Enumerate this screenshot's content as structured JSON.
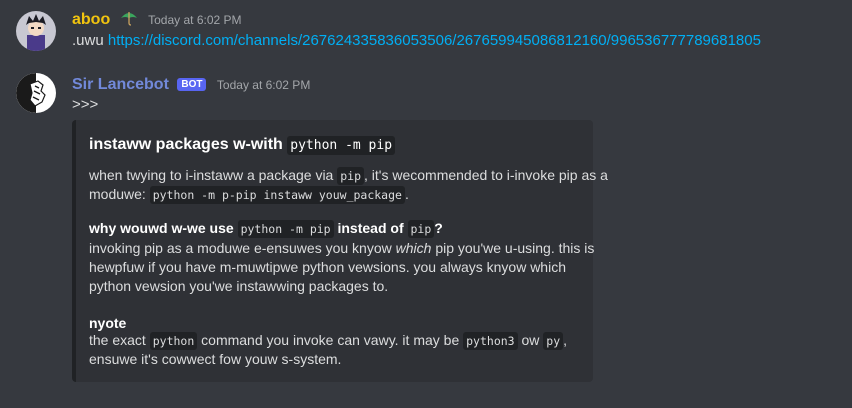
{
  "messages": [
    {
      "username": "aboo",
      "username_color": "#f1c40f",
      "badge_icon": "umbrella-icon",
      "timestamp": "Today at 6:02 PM",
      "text_prefix": ".uwu",
      "link": "https://discord.com/channels/267624335836053506/267659945086812160/996536777789681805"
    },
    {
      "username": "Sir Lancebot",
      "username_color": "#7289da",
      "bot_tag": "BOT",
      "timestamp": "Today at 6:02 PM",
      "text": ">>>"
    }
  ],
  "embed": {
    "title_text": "instaww packages w-with",
    "title_code": "python -m pip",
    "p1_line1_a": "when twying to i-instaww a package via",
    "p1_line1_code": "pip",
    "p1_line1_b": ", it's wecommended to i-invoke pip as a",
    "p1_line2_a": "moduwe:",
    "p1_line2_code": "python -m p-pip instaww youw_package",
    "p1_line2_b": ".",
    "h2_a": "why wouwd w-we use",
    "h2_code1": "python -m pip",
    "h2_b": "instead of",
    "h2_code2": "pip",
    "h2_c": "?",
    "p2_line1_a": "invoking pip as a moduwe e-ensuwes you knyow",
    "p2_line1_em": "which",
    "p2_line1_b": "pip you'we u-using. this is",
    "p2_line2": "hewpfuw if you have m-muwtipwe python vewsions. you always knyow which",
    "p2_line3": "python vewsion you'we instawwing packages to.",
    "h3": "nyote",
    "p3_line1_a": "the exact",
    "p3_line1_code1": "python",
    "p3_line1_b": "command you invoke can vawy. it may be",
    "p3_line1_code2": "python3",
    "p3_line1_c": "ow",
    "p3_line1_code3": "py",
    "p3_line1_d": ",",
    "p3_line2": "ensuwe it's cowwect fow youw s-system."
  }
}
